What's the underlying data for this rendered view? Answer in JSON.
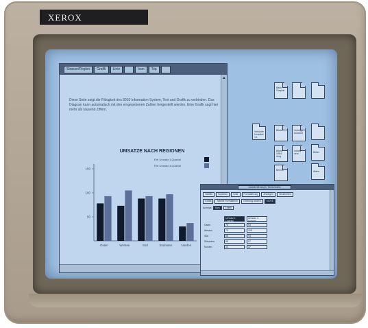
{
  "monitor": {
    "brand": "XEROX"
  },
  "doc_window": {
    "commands": [
      "Strasse/Region",
      "Grafik",
      "Linie",
      "",
      "Icon",
      "Top",
      ""
    ],
    "body_text": "Diese Seite zeigt die Fähigkeit des 8010 Information System, Text und Grafik zu verbinden. Das Diagram kann automatisch mit den eingegebenen Zahlen hergestellt werden. Eine Grafik sagt hier mehr als tausend Ziffern."
  },
  "chart_data": {
    "type": "bar",
    "title": "UMSATZE NACH REGIONEN",
    "categories": [
      "Osten",
      "Westen",
      "Süd",
      "Südosten",
      "Norden"
    ],
    "series": [
      {
        "name": "Ertr Umsatz 1.Quartal",
        "values": [
          78,
          73,
          88,
          88,
          30
        ]
      },
      {
        "name": "Ertr Umsatz 4.Quartal",
        "values": [
          93,
          105,
          93,
          97,
          37
        ]
      }
    ],
    "y_ticks": [
      "150",
      "100",
      "50"
    ],
    "ylim": [
      0,
      160
    ],
    "colors": [
      "#0f1a2c",
      "#5b6f98"
    ],
    "legend": "top-right"
  },
  "desktop_icons": [
    {
      "kind": "doc",
      "label": "Bank Graphic"
    },
    {
      "kind": "doc",
      "label": ""
    },
    {
      "kind": "folder",
      "label": ""
    },
    {
      "kind": "folder",
      "label": "Verkäufe Umsätze 1.1"
    },
    {
      "kind": "doc",
      "label": "Bilanz"
    },
    {
      "kind": "doc",
      "label": "Verträge Ausland"
    },
    {
      "kind": "folder",
      "label": ""
    },
    {
      "kind": "doc",
      "label": "Bilanz 1984 Verg."
    },
    {
      "kind": "doc",
      "label": "Inhalts verz."
    },
    {
      "kind": "folder",
      "label": "Bilder"
    },
    {
      "kind": "doc",
      "label": "Bericht"
    },
    {
      "kind": "folder",
      "label": "Akten"
    }
  ],
  "sheet_window": {
    "title": "UMSATZE NACH REGIONEN",
    "tools": [
      "Tabelle",
      "Kopieren",
      "Linie",
      "Formatierung",
      "Anzeigen",
      "Verarbeiten"
    ],
    "tools2": [
      "Grafik",
      "Tabelle Formatieren",
      "Ordnung ändern",
      "MOVE"
    ],
    "mode_label": "Anzeige",
    "mode_options": [
      "Bars",
      "Linien"
    ],
    "headers": [
      "Umsatz 1. Quartal",
      "Umsatz 4. Quartal"
    ],
    "rows": [
      {
        "label": "Osten",
        "v1": "78",
        "v2": "93"
      },
      {
        "label": "Westen",
        "v1": "73",
        "v2": "105"
      },
      {
        "label": "Süd",
        "v1": "88",
        "v2": "93"
      },
      {
        "label": "Südosten",
        "v1": "88",
        "v2": "97"
      },
      {
        "label": "Norden",
        "v1": "30",
        "v2": "37"
      }
    ]
  }
}
